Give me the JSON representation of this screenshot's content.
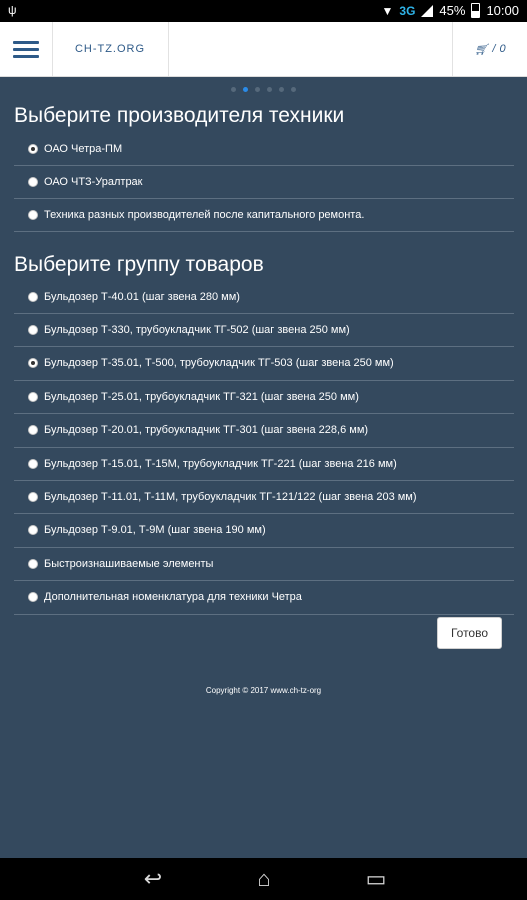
{
  "status_bar": {
    "network": "3G",
    "battery": "45%",
    "time": "10:00"
  },
  "app_bar": {
    "brand": "CH-TZ.ORG",
    "cart_count": "0"
  },
  "carousel": {
    "dots": 6,
    "active_index": 1
  },
  "manufacturers": {
    "heading": "Выберите производителя техники",
    "options": [
      {
        "label": "ОАО Четра-ПМ",
        "checked": true
      },
      {
        "label": "ОАО ЧТЗ-Уралтрак",
        "checked": false
      },
      {
        "label": "Техника разных производителей после капитального ремонта.",
        "checked": false
      }
    ]
  },
  "product_groups": {
    "heading": "Выберите группу товаров",
    "options": [
      {
        "label": "Бульдозер Т-40.01 (шаг звена 280 мм)",
        "checked": false
      },
      {
        "label": "Бульдозер Т-330, трубоукладчик ТГ-502 (шаг звена 250 мм)",
        "checked": false
      },
      {
        "label": "Бульдозер Т-35.01, Т-500, трубоукладчик ТГ-503 (шаг звена 250 мм)",
        "checked": true
      },
      {
        "label": "Бульдозер Т-25.01, трубоукладчик ТГ-321 (шаг звена 250 мм)",
        "checked": false
      },
      {
        "label": "Бульдозер Т-20.01, трубоукладчик ТГ-301 (шаг звена 228,6 мм)",
        "checked": false
      },
      {
        "label": "Бульдозер Т-15.01, Т-15М, трубоукладчик ТГ-221 (шаг звена 216 мм)",
        "checked": false
      },
      {
        "label": "Бульдозер Т-11.01, Т-11М, трубоукладчик ТГ-121/122 (шаг звена 203 мм)",
        "checked": false
      },
      {
        "label": "Бульдозер Т-9.01, Т-9М (шаг звена 190 мм)",
        "checked": false
      },
      {
        "label": "Быстроизнашиваемые элементы",
        "checked": false
      },
      {
        "label": "Дополнительная номенклатура для техники Четра",
        "checked": false
      }
    ]
  },
  "done_button": "Готово",
  "footer": "Copyright © 2017 www.ch-tz-org"
}
